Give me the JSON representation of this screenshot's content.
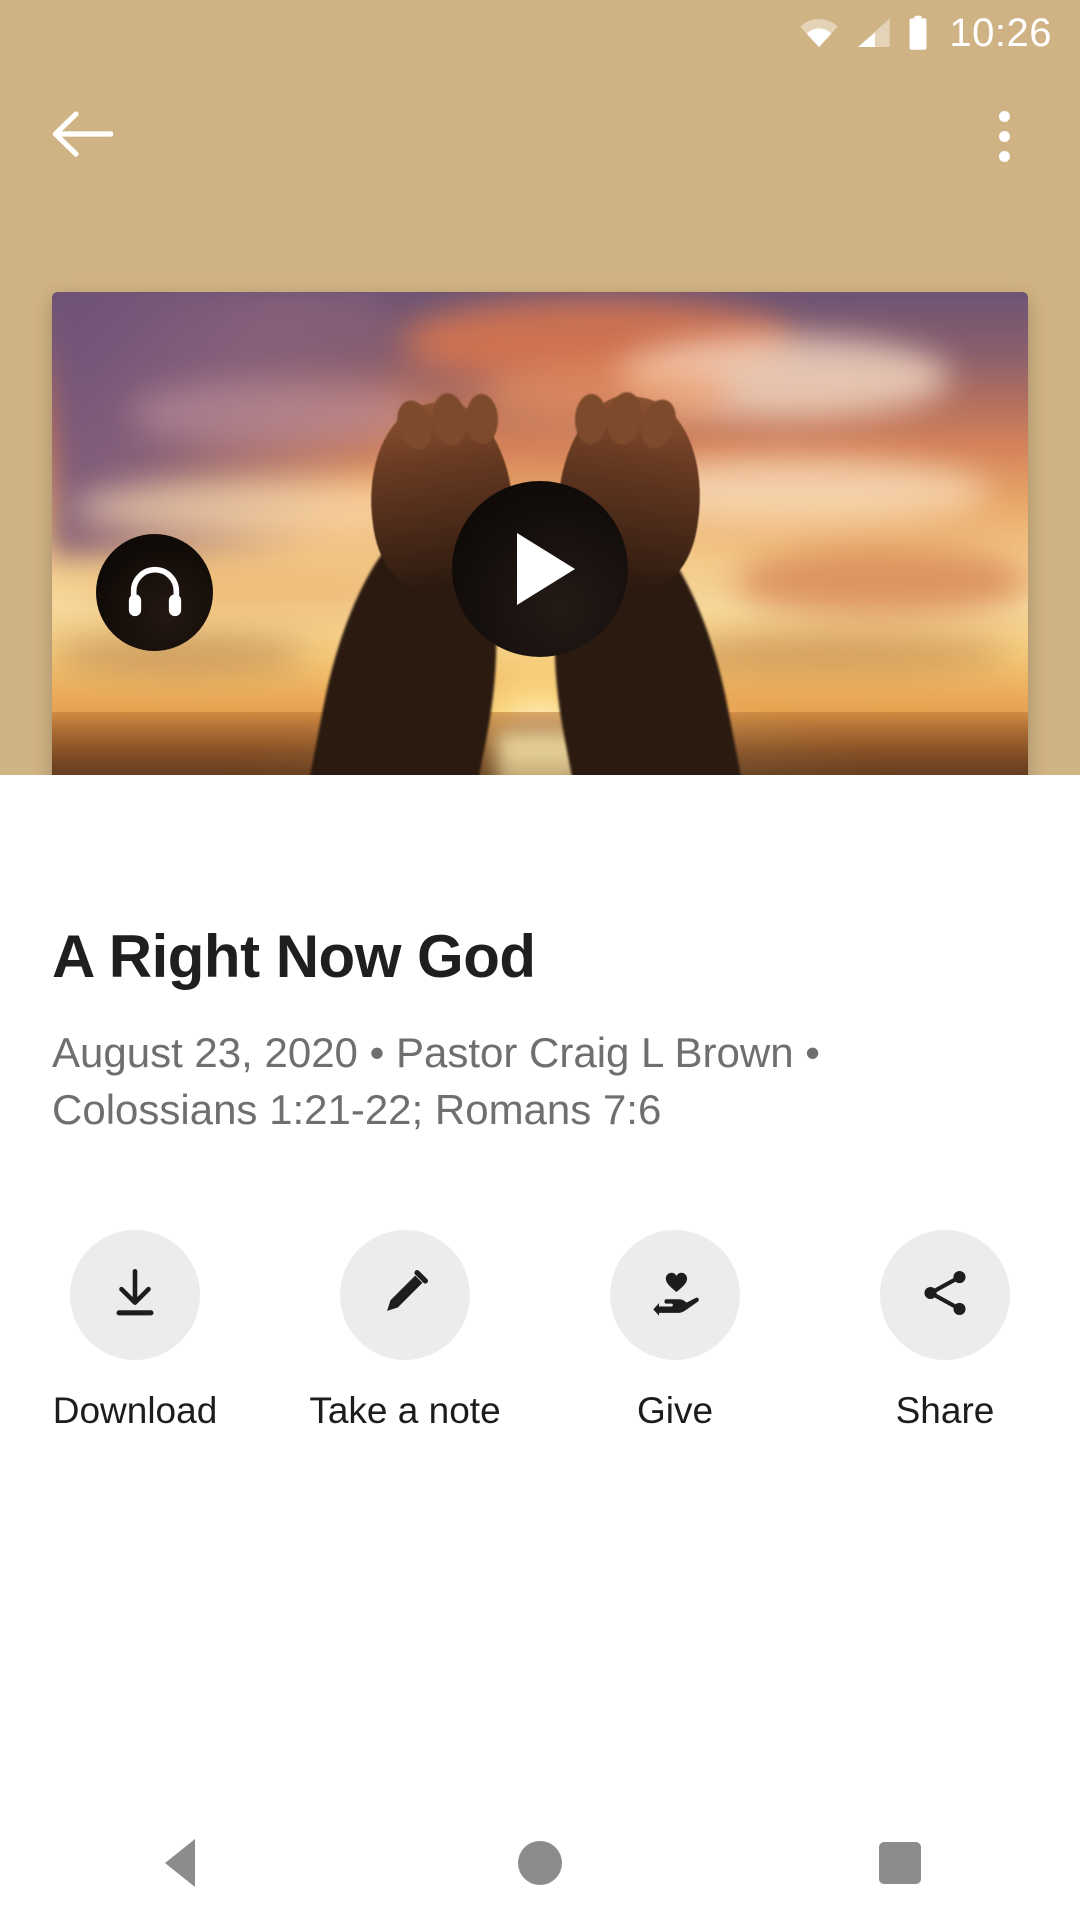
{
  "status_bar": {
    "time": "10:26",
    "wifi_icon": "wifi-icon",
    "cellular_icon": "cellular-signal-icon",
    "battery_icon": "battery-full-icon"
  },
  "app_bar": {
    "back_icon": "back-arrow-icon",
    "overflow_icon": "more-vertical-icon"
  },
  "player": {
    "play_icon": "play-icon",
    "headphones_icon": "headphones-icon",
    "thumbnail_alt": "hands raised toward sunset sky"
  },
  "sermon": {
    "title": "A Right Now God",
    "meta": "August 23, 2020 • Pastor Craig L Brown • Colossians 1:21-22; Romans 7:6"
  },
  "actions": [
    {
      "label": "Download",
      "icon": "download-icon"
    },
    {
      "label": "Take a note",
      "icon": "pencil-icon"
    },
    {
      "label": "Give",
      "icon": "hand-heart-icon"
    },
    {
      "label": "Share",
      "icon": "share-icon"
    }
  ],
  "nav_bar": {
    "back_label": "back-icon",
    "home_label": "home-icon",
    "recents_label": "recents-icon"
  },
  "colors": {
    "header_band": "#d0b384",
    "sheet_background": "#ffffff",
    "title_text": "#1f1f1f",
    "meta_text": "#6f6f6f",
    "action_circle": "#ececec",
    "nav_icon": "#8c8c8c"
  }
}
